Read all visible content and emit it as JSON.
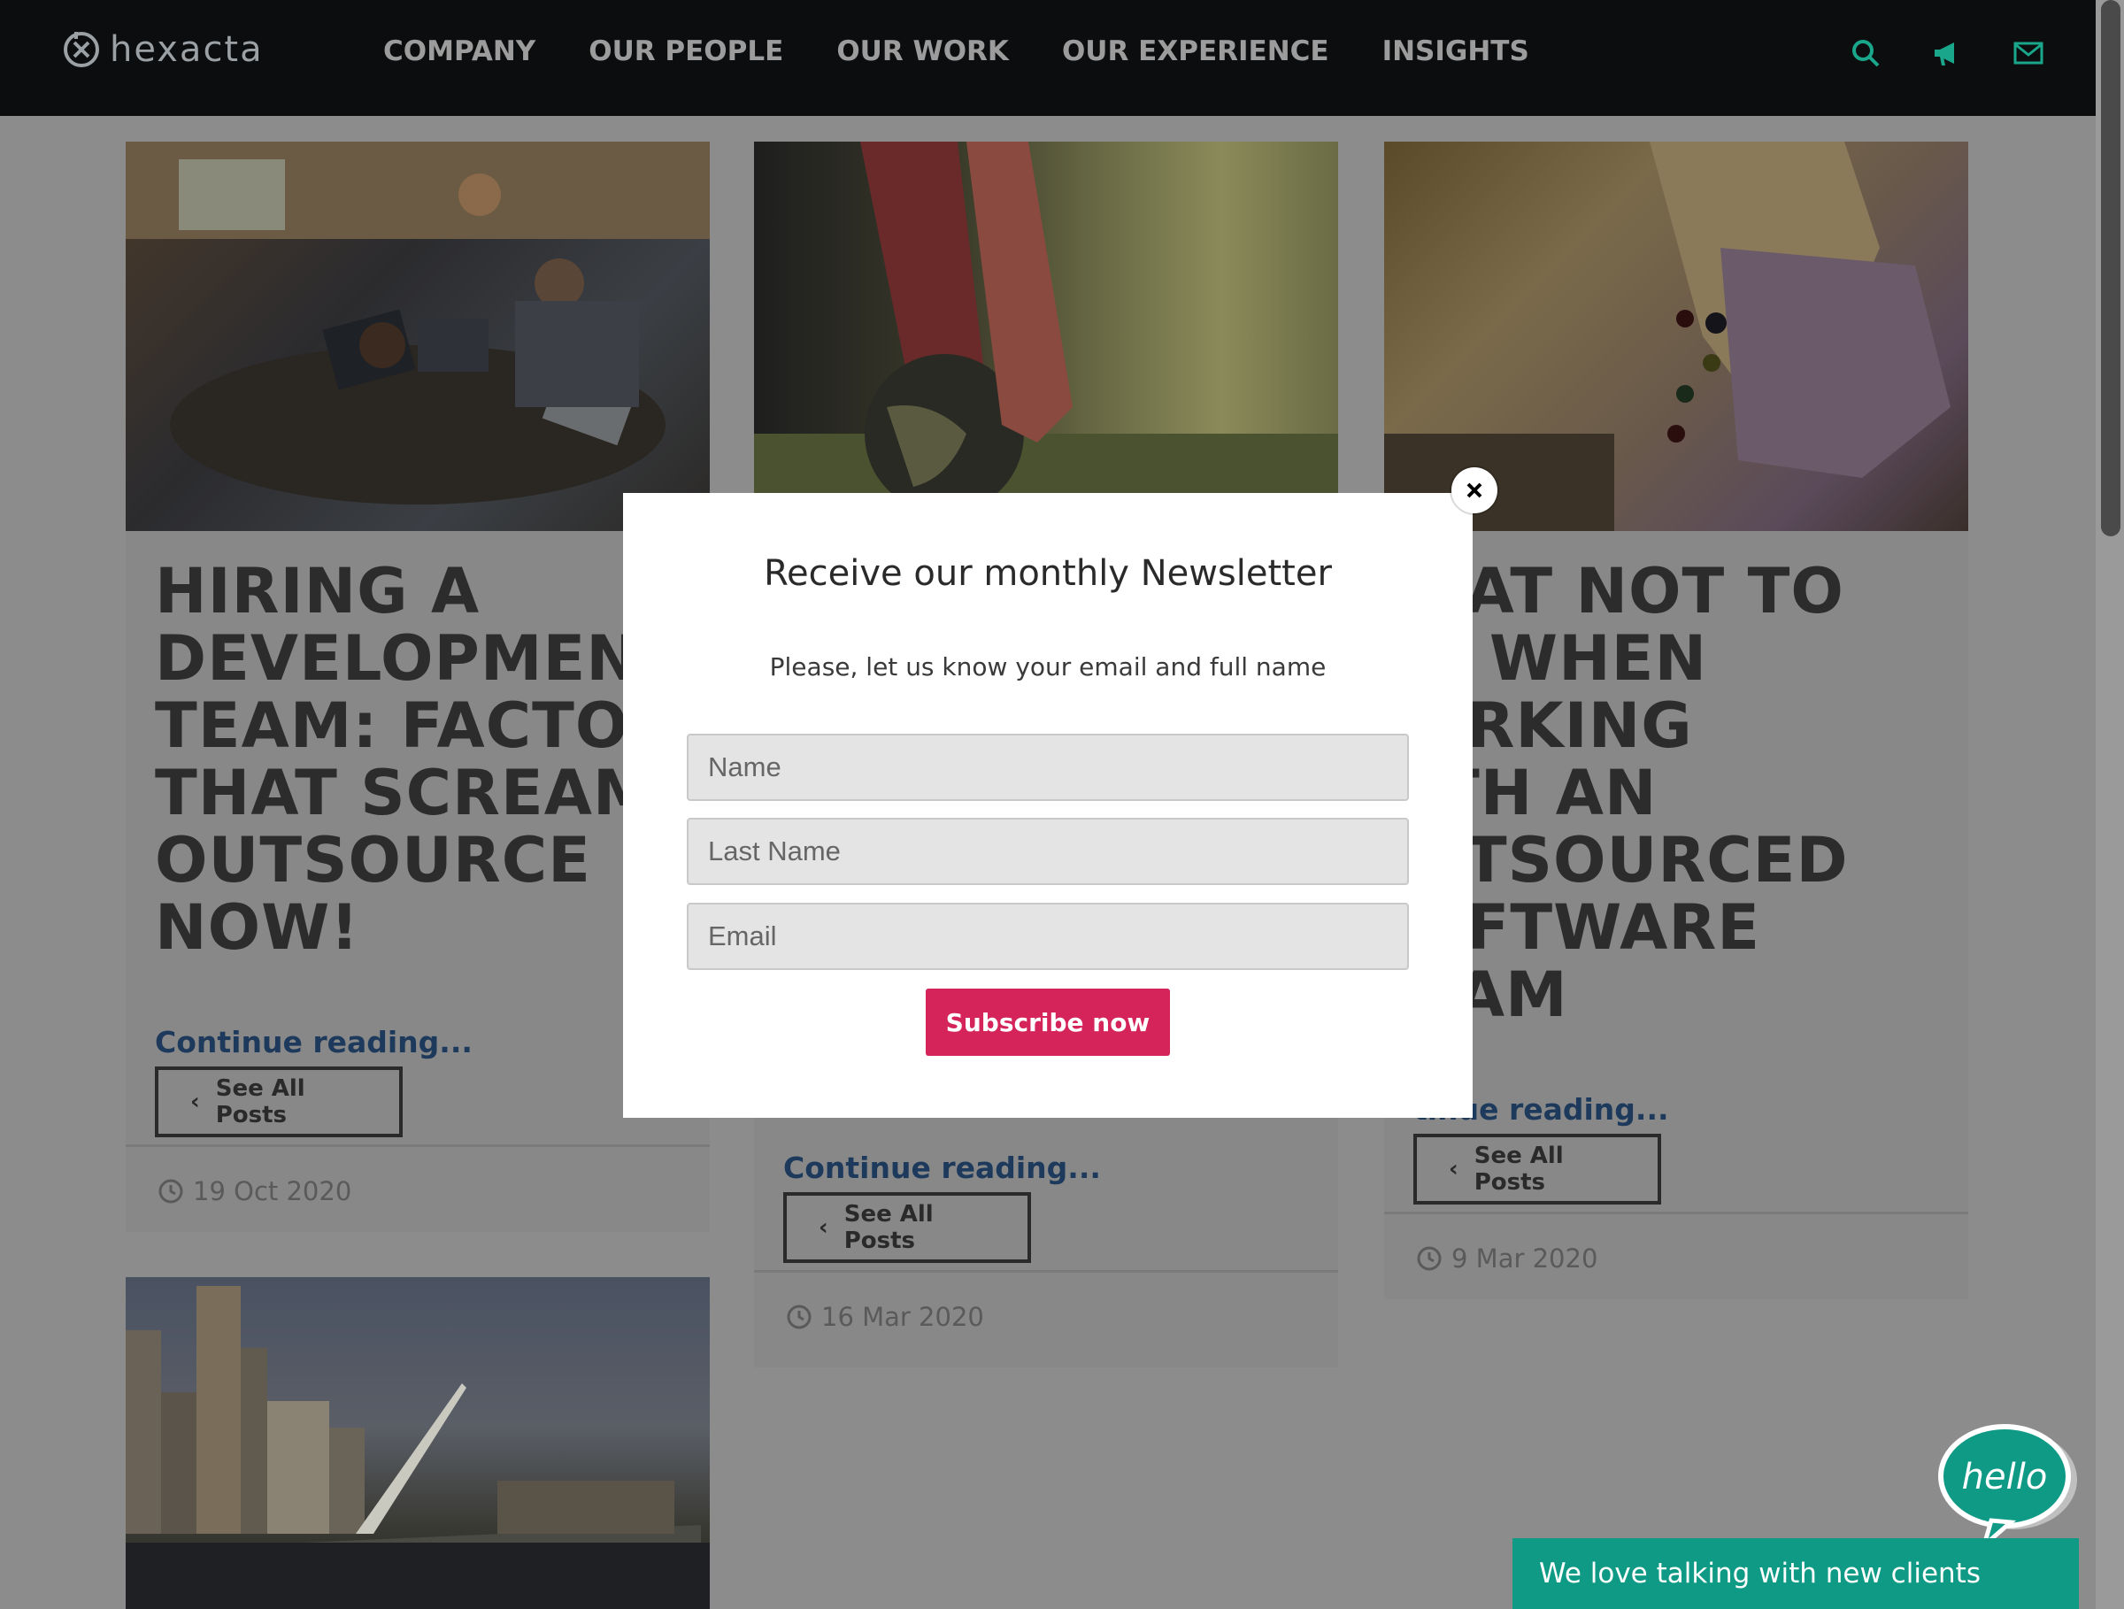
{
  "brand": {
    "name": "hexacta"
  },
  "nav": {
    "items": [
      "COMPANY",
      "OUR PEOPLE",
      "OUR WORK",
      "OUR EXPERIENCE",
      "INSIGHTS"
    ],
    "icons": [
      "search-icon",
      "megaphone-icon",
      "mail-icon"
    ],
    "accent": "#1aa68a"
  },
  "posts": [
    {
      "title": "HIRING A DEVELOPMENT TEAM: FACTORS THAT SCREAM OUTSOURCE NOW!",
      "title_visible": [
        "HIRING A",
        "DEVELOPMENT",
        "TEAM: FACTOR",
        "THAT SCREAM",
        "OUTSOURCE",
        "NOW!"
      ],
      "continue": "Continue reading...",
      "see_all": "See All Posts",
      "date": "19 Oct 2020"
    },
    {
      "continue": "Continue reading...",
      "see_all": "See All Posts",
      "date": "16 Mar 2020"
    },
    {
      "title_visible": [
        "HAT NOT TO",
        "O WHEN",
        "ORKING",
        "ITH AN",
        "UTSOURCED",
        "OFTWARE",
        "EAM"
      ],
      "continue": "tinue reading...",
      "see_all": "See All Posts",
      "date": "9 Mar 2020"
    }
  ],
  "modal": {
    "title": "Receive our monthly Newsletter",
    "subtitle": "Please, let us know your email and full name",
    "fields": {
      "name": "Name",
      "last_name": "Last Name",
      "email": "Email"
    },
    "submit": "Subscribe now",
    "button_color": "#d4245a"
  },
  "chat": {
    "bubble": "hello",
    "bar_text": "We love talking with new clients",
    "color": "#0f9a85"
  }
}
